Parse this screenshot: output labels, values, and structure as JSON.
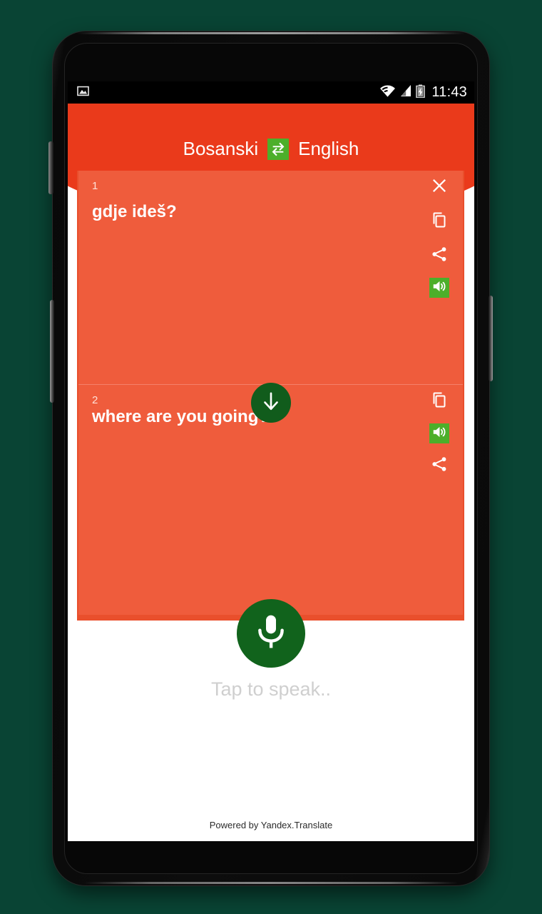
{
  "device": {
    "hardware": {
      "front_camera": "front-camera",
      "proximity_sensor": "proximity-sensor",
      "earpiece": "earpiece-speaker",
      "volume_rocker": "volume-rocker",
      "power_button": "power-button"
    }
  },
  "status_bar": {
    "left_icons": [
      {
        "name": "image-icon",
        "glyph": "image"
      }
    ],
    "right_icons": [
      {
        "name": "wifi-icon",
        "glyph": "wifi"
      },
      {
        "name": "cellular-signal-icon",
        "glyph": "signal"
      },
      {
        "name": "battery-charging-icon",
        "glyph": "battery"
      }
    ],
    "clock": "11:43"
  },
  "header": {
    "source_language": "Bosanski",
    "target_language": "English",
    "swap_icon": "swap-horizontal-icon",
    "swap_button_color": "#4caf2a",
    "band_color": "#ea3a1b"
  },
  "cards": [
    {
      "index": "1",
      "text": "gdje ideš?",
      "role": "source",
      "actions": [
        {
          "name": "close-icon",
          "label": "Close",
          "style": "plain"
        },
        {
          "name": "copy-icon",
          "label": "Copy",
          "style": "plain"
        },
        {
          "name": "share-icon",
          "label": "Share",
          "style": "plain"
        },
        {
          "name": "speaker-icon",
          "label": "Speak",
          "style": "green"
        }
      ]
    },
    {
      "index": "2",
      "text": "where are you going?",
      "role": "target",
      "actions": [
        {
          "name": "copy-icon",
          "label": "Copy",
          "style": "plain"
        },
        {
          "name": "speaker-icon",
          "label": "Speak",
          "style": "green"
        },
        {
          "name": "share-icon",
          "label": "Share",
          "style": "plain"
        }
      ]
    }
  ],
  "swap_direction": {
    "name": "arrow-down-icon",
    "label": "Translate direction down",
    "color": "#115c1c"
  },
  "mic": {
    "name": "microphone-icon",
    "label": "Tap to speak..",
    "color": "#11631c"
  },
  "footer": {
    "powered_by": "Powered by Yandex.Translate"
  },
  "colors": {
    "background": "#094434",
    "header_red": "#ea3a1b",
    "card_panel_red": "#e94f2c",
    "card_red": "#ef5c3c",
    "accent_green": "#4caf2a",
    "dark_green": "#11631c",
    "hint_gray": "#cfcfcf"
  }
}
